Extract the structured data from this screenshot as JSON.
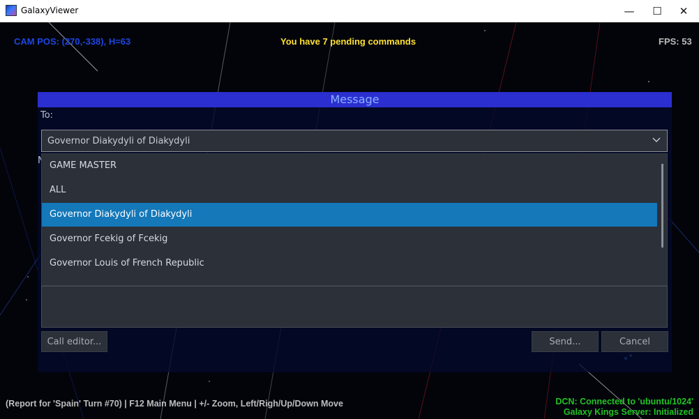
{
  "window": {
    "title": "GalaxyViewer",
    "controls": {
      "minimize": "—",
      "maximize": "☐",
      "close": "✕"
    }
  },
  "hud": {
    "cam_pos": "CAM POS: (270,-338), H=63",
    "pending": "You have 7 pending commands",
    "fps": "FPS: 53",
    "report": "(Report for 'Spain' Turn #70) | F12 Main Menu | +/- Zoom, Left/Righ/Up/Down Move",
    "dcn_line1": "DCN: Connected to 'ubuntu/1024'",
    "dcn_line2": "Galaxy Kings Server: Initialized"
  },
  "dialog": {
    "title": "Message",
    "to_label": "To:",
    "next_label_fragment": "N",
    "recipient_selected": "Governor Diakydyli of Diakydyli",
    "options": [
      "GAME MASTER",
      "ALL",
      "Governor Diakydyli of Diakydyli",
      "Governor Fcekig of Fcekig",
      "Governor Louis of French Republic"
    ],
    "selected_index": 2,
    "buttons": {
      "call_editor": "Call editor...",
      "send": "Send...",
      "cancel": "Cancel"
    }
  },
  "icons": {
    "app": "galaxy-app-icon",
    "dropdown": "chevron-down-icon"
  },
  "colors": {
    "dialog_header": "#2b2fd0",
    "selected_option": "#1478b9",
    "cam_pos": "#1e46e0",
    "pending": "#ffe033",
    "status_ok": "#22c322"
  }
}
